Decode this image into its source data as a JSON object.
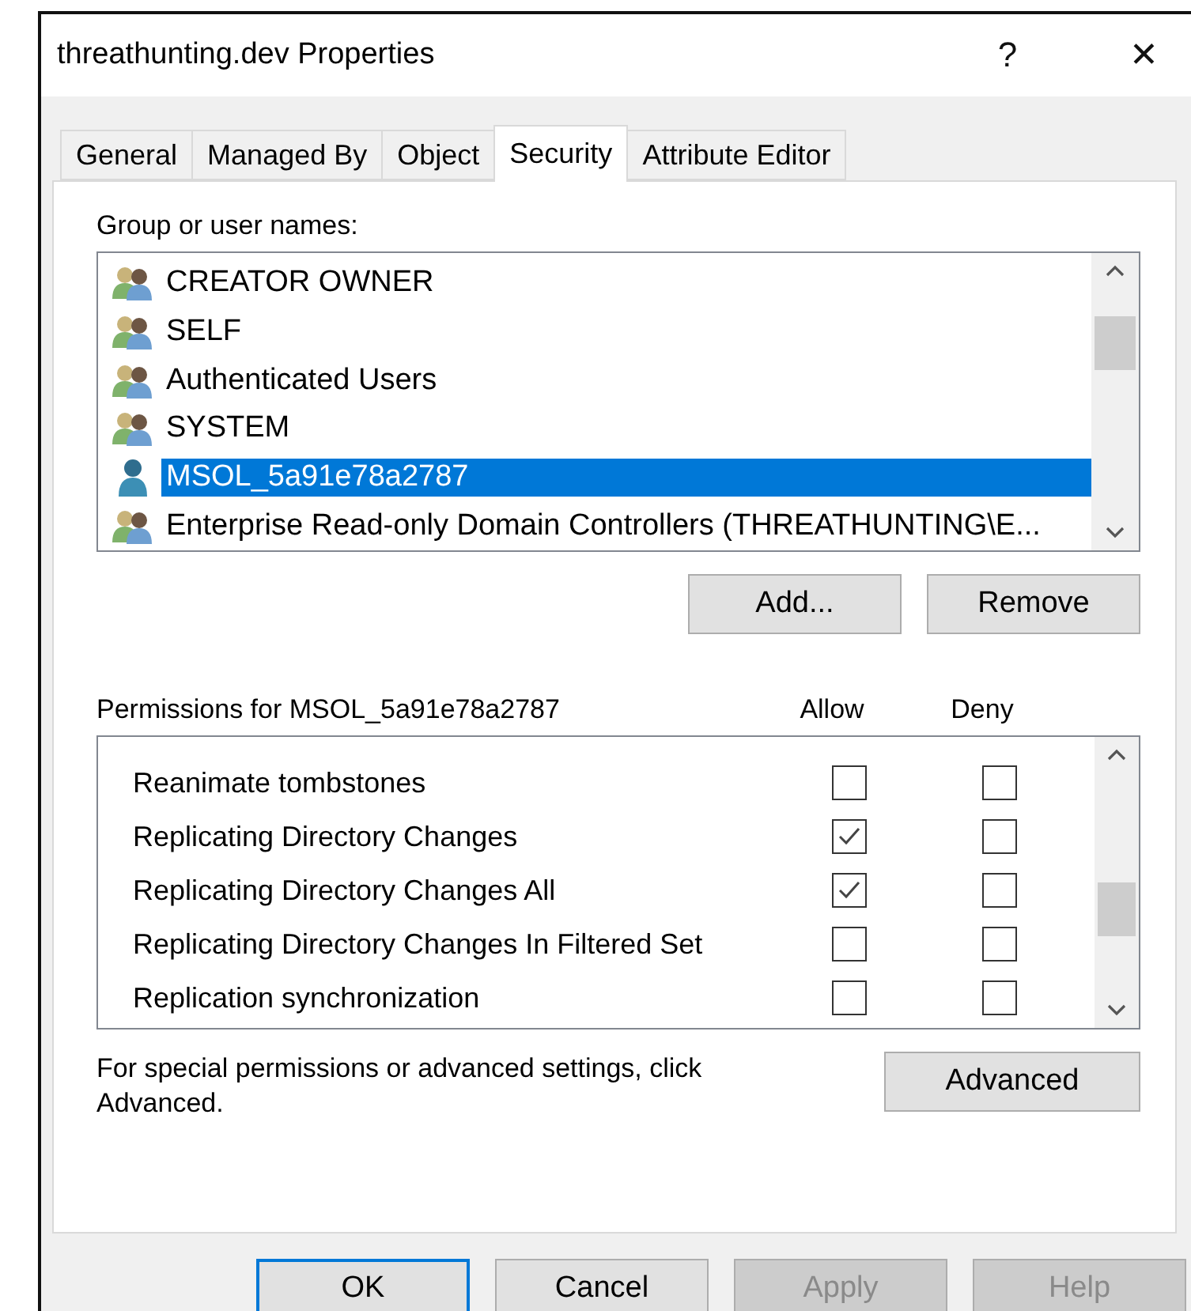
{
  "window": {
    "title": "threathunting.dev Properties",
    "title_buttons": [
      "?",
      "✕"
    ]
  },
  "tabs": [
    {
      "label": "General",
      "selected": false
    },
    {
      "label": "Managed By",
      "selected": false
    },
    {
      "label": "Object",
      "selected": false
    },
    {
      "label": "Security",
      "selected": true
    },
    {
      "label": "Attribute Editor",
      "selected": false
    }
  ],
  "groups": {
    "label": "Group or user names:",
    "items": [
      {
        "name": "CREATOR OWNER",
        "kind": "group",
        "selected": false
      },
      {
        "name": "SELF",
        "kind": "group",
        "selected": false
      },
      {
        "name": "Authenticated Users",
        "kind": "group",
        "selected": false
      },
      {
        "name": "SYSTEM",
        "kind": "group",
        "selected": false
      },
      {
        "name": "MSOL_5a91e78a2787",
        "kind": "user",
        "selected": true
      },
      {
        "name": "Enterprise Read-only Domain Controllers (THREATHUNTING\\E...",
        "kind": "group",
        "selected": false
      }
    ],
    "buttons": [
      "Add...",
      "Remove"
    ]
  },
  "permissions": {
    "label": "Permissions for MSOL_5a91e78a2787",
    "columns": [
      "Allow",
      "Deny"
    ],
    "rows": [
      {
        "name": "Reanimate tombstones",
        "allow": false,
        "deny": false
      },
      {
        "name": "Replicating Directory Changes",
        "allow": true,
        "deny": false
      },
      {
        "name": "Replicating Directory Changes All",
        "allow": true,
        "deny": false
      },
      {
        "name": "Replicating Directory Changes In Filtered Set",
        "allow": false,
        "deny": false
      },
      {
        "name": "Replication synchronization",
        "allow": false,
        "deny": false
      }
    ]
  },
  "advanced": {
    "text": "For special permissions or advanced settings, click Advanced.",
    "button": "Advanced"
  },
  "buttons": [
    {
      "label": "OK",
      "disabled": false,
      "default": true
    },
    {
      "label": "Cancel",
      "disabled": false,
      "default": false
    },
    {
      "label": "Apply",
      "disabled": true,
      "default": false
    },
    {
      "label": "Help",
      "disabled": true,
      "default": false
    }
  ]
}
